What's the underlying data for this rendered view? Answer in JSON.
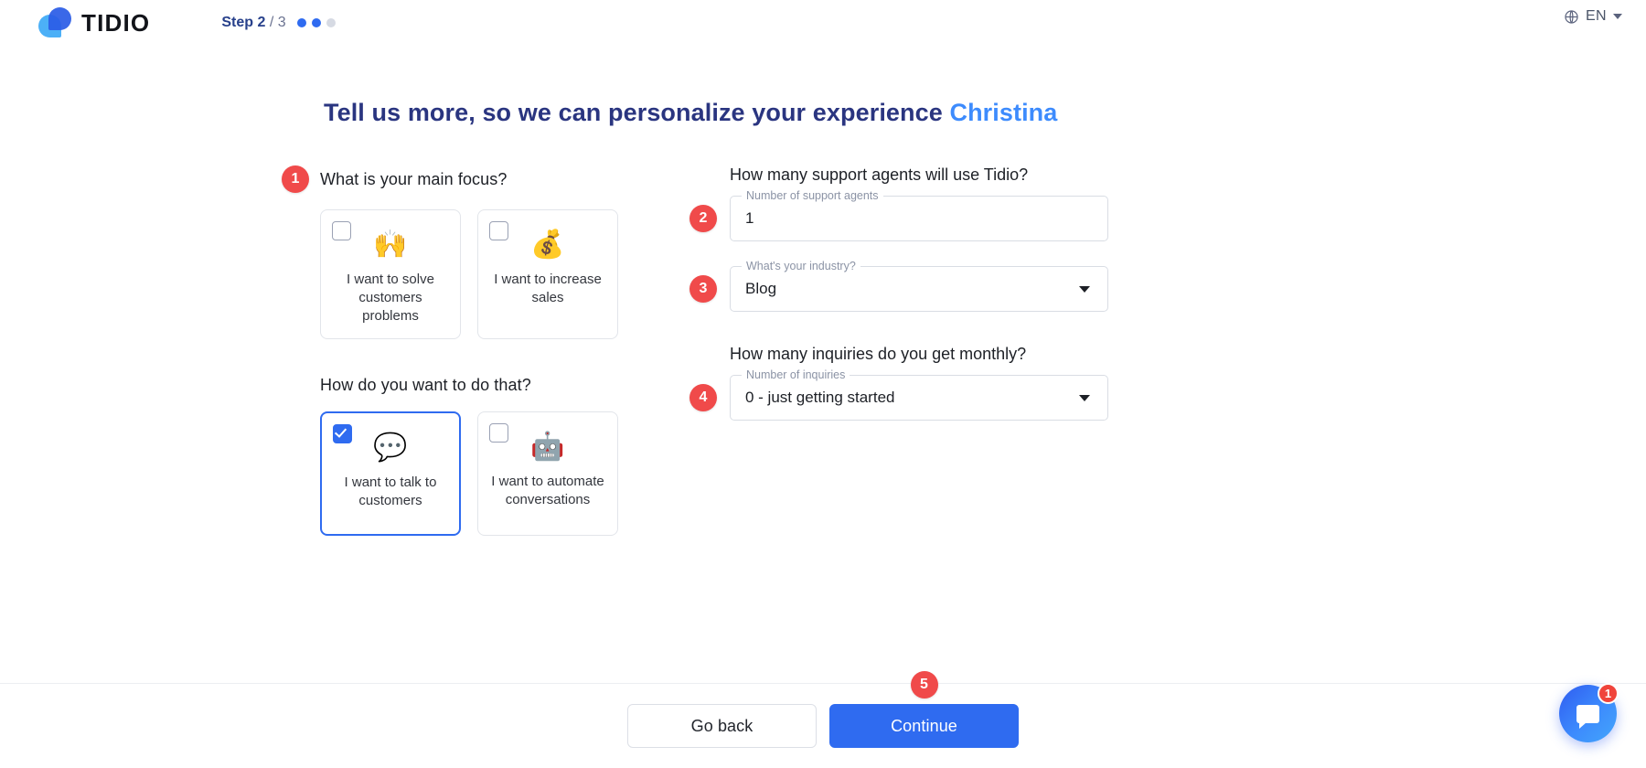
{
  "header": {
    "logo_text": "TIDIO",
    "step_label": "Step 2",
    "step_total": "/ 3",
    "dots_total": 3,
    "dots_active": 2,
    "language_code": "EN"
  },
  "main": {
    "title_text": "Tell us more, so we can personalize your experience",
    "title_name": "Christina"
  },
  "left": {
    "badge_1": "1",
    "question_1": "What is your main focus?",
    "question_2": "How do you want to do that?",
    "focus_options": [
      {
        "label": "I want to solve customers problems",
        "emoji": "🙌",
        "icon_name": "raising-hands-emoji",
        "checked": false
      },
      {
        "label": "I want to increase sales",
        "emoji": "💰",
        "icon_name": "money-bag-emoji",
        "checked": false
      }
    ],
    "method_options": [
      {
        "label": "I want to talk to customers",
        "emoji": "💬",
        "icon_name": "speech-balloon-emoji",
        "checked": true
      },
      {
        "label": "I want to automate conversations",
        "emoji": "🤖",
        "icon_name": "robot-emoji",
        "checked": false
      }
    ]
  },
  "right": {
    "badge_2": "2",
    "badge_3": "3",
    "badge_4": "4",
    "question_agents": "How many support agents will use Tidio?",
    "agents_label": "Number of support agents",
    "agents_value": "1",
    "industry_label": "What's your industry?",
    "industry_value": "Blog",
    "question_inquiries": "How many inquiries do you get monthly?",
    "inquiries_label": "Number of inquiries",
    "inquiries_value": "0 - just getting started"
  },
  "footer": {
    "badge_5": "5",
    "go_back_label": "Go back",
    "continue_label": "Continue"
  },
  "chat": {
    "unread_count": "1"
  },
  "colors": {
    "accent_blue": "#2f6bf0",
    "title_navy": "#2a3580",
    "name_blue": "#3d8bfd",
    "badge_red": "#f04a4a"
  }
}
